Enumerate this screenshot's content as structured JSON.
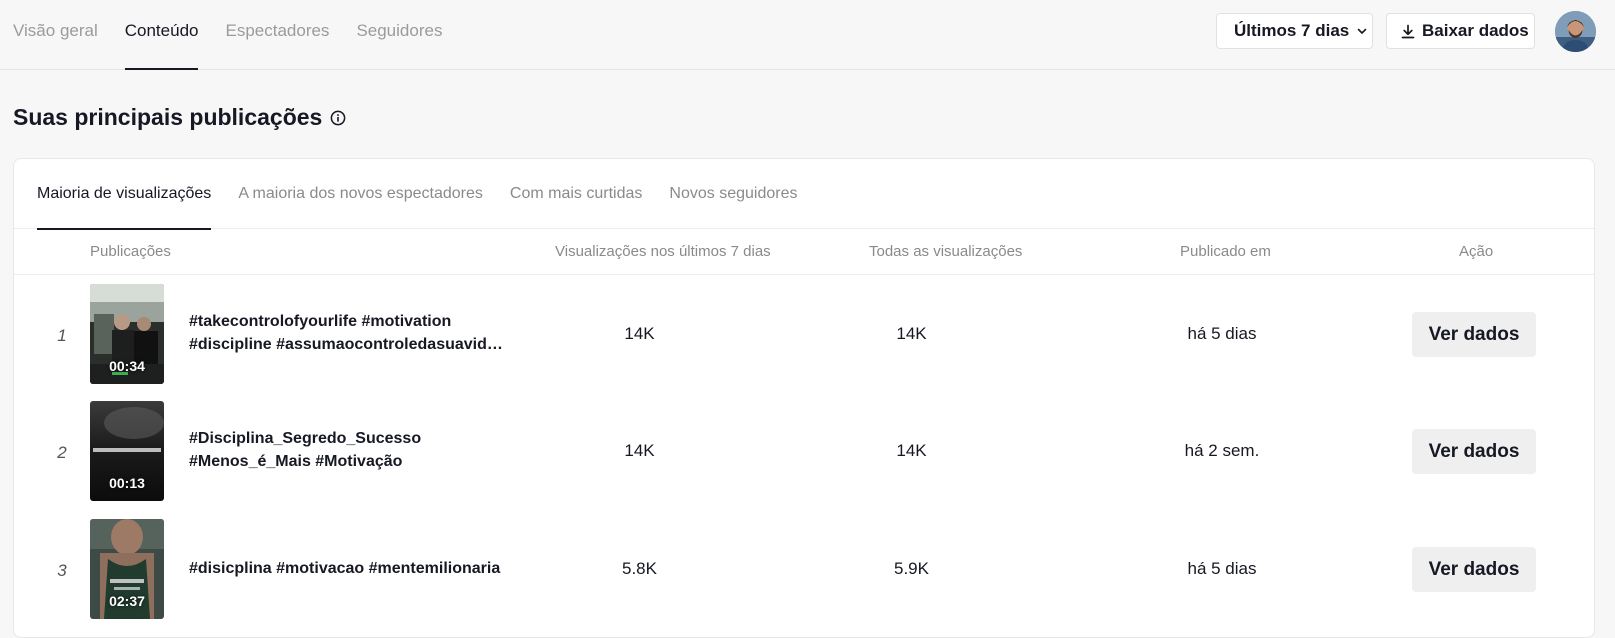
{
  "top_nav": {
    "tabs": [
      {
        "label": "Visão geral",
        "active": false
      },
      {
        "label": "Conteúdo",
        "active": true
      },
      {
        "label": "Espectadores",
        "active": false
      },
      {
        "label": "Seguidores",
        "active": false
      }
    ],
    "range_label": "Últimos 7 dias",
    "download_label": "Baixar dados"
  },
  "section": {
    "title": "Suas principais publicações",
    "info_icon": "info-circle-icon"
  },
  "sub_tabs": [
    {
      "label": "Maioria de visualizações",
      "active": true
    },
    {
      "label": "A maioria dos novos espectadores",
      "active": false
    },
    {
      "label": "Com mais curtidas",
      "active": false
    },
    {
      "label": "Novos seguidores",
      "active": false
    }
  ],
  "table": {
    "headers": {
      "posts": "Publicações",
      "views_7d": "Visualizações nos últimos 7 dias",
      "all_views": "Todas as visualizações",
      "published": "Publicado em",
      "action": "Ação"
    },
    "rows": [
      {
        "rank": "1",
        "duration": "00:34",
        "caption_line1": "#takecontrolofyourlife #motivation",
        "caption_line2": "#discipline #assumaocontroledasuavida...",
        "views_7d": "14K",
        "all_views": "14K",
        "published": "há 5 dias",
        "action": "Ver dados"
      },
      {
        "rank": "2",
        "duration": "00:13",
        "caption_line1": "#Disciplina_Segredo_Sucesso",
        "caption_line2": "#Menos_é_Mais #Motivação",
        "views_7d": "14K",
        "all_views": "14K",
        "published": "há 2 sem.",
        "action": "Ver dados"
      },
      {
        "rank": "3",
        "duration": "02:37",
        "caption_line1": "#disicplina #motivacao #mentemilionaria",
        "caption_line2": "",
        "views_7d": "5.8K",
        "all_views": "5.9K",
        "published": "há 5 dias",
        "action": "Ver dados"
      }
    ]
  },
  "colors": {
    "text": "#161823",
    "muted": "#8a8a8a",
    "page_bg": "#f8f7f7",
    "button_bg": "#efefef"
  }
}
